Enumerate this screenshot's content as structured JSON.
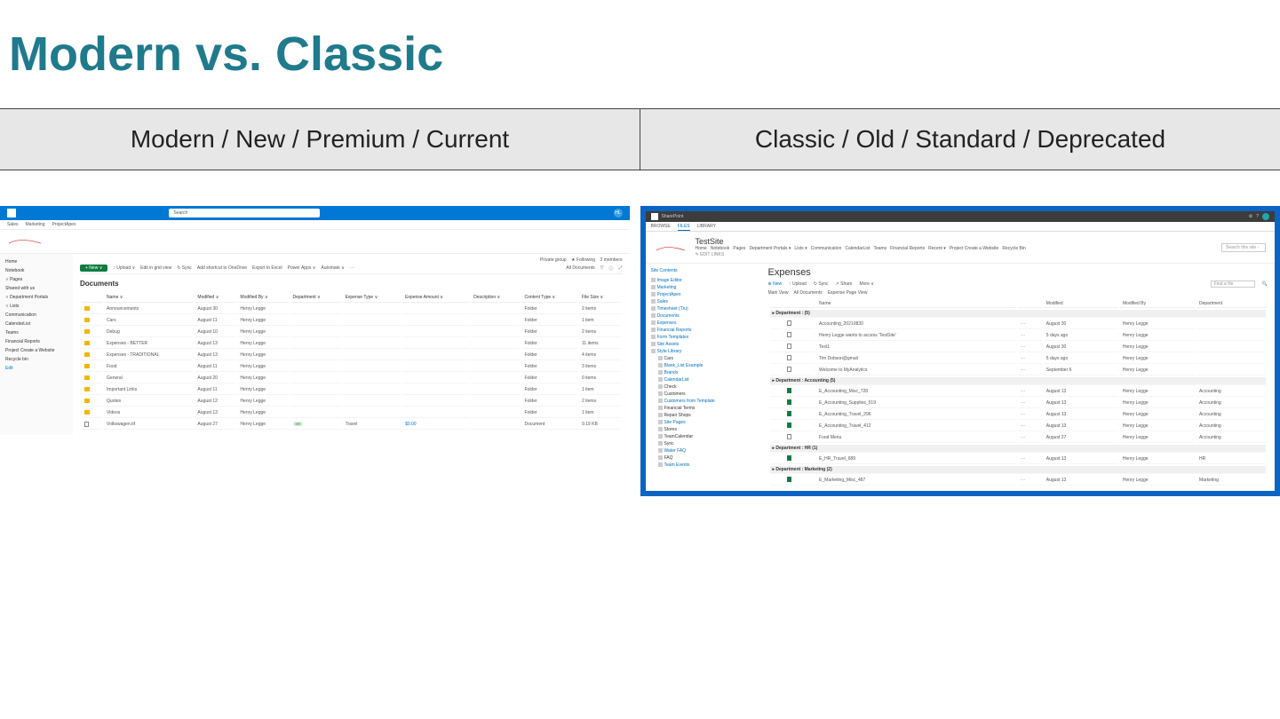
{
  "slide_title": "Modern vs. Classic",
  "header_left": "Modern / New / Premium / Current",
  "header_right": "Classic / Old / Standard / Deprecated",
  "modern": {
    "search_placeholder": "Search",
    "avatar": "HL",
    "tabs": [
      "Sales",
      "Marketing",
      "ProjectApex"
    ],
    "meta": {
      "group": "Private group",
      "follow": "★ Following",
      "members": "3 members"
    },
    "toolbar": {
      "new": "+ New ∨",
      "upload": "↑ Upload ∨",
      "edit": "Edit in grid view",
      "sync": "↻ Sync",
      "shortcut": "Add shortcut to OneDrive",
      "export": "Export to Excel",
      "powerapps": "Power Apps ∨",
      "automate": "Automate ∨",
      "more": "···",
      "alldocs": "All Documents"
    },
    "nav": [
      "Home",
      "Notebook",
      "Pages",
      "Shared with us",
      "Department Portals",
      "Lists",
      "Communication",
      "CalendarList",
      "Teams",
      "Financial Reports",
      "Project Create a Website",
      "Recycle bin",
      "Edit"
    ],
    "doctitle": "Documents",
    "columns": [
      "",
      "Name ∨",
      "Modified ∨",
      "Modified By ∨",
      "Department ∨",
      "Expense Type ∨",
      "Expense Amount ∨",
      "Description ∨",
      "Content Type ∨",
      "File Size ∨"
    ],
    "rows": [
      {
        "icon": "folder",
        "name": "Announcements",
        "mod": "August 30",
        "by": "Henry Legge",
        "ct": "Folder",
        "size": "2 items"
      },
      {
        "icon": "folder",
        "name": "Cars",
        "mod": "August 11",
        "by": "Henry Legge",
        "ct": "Folder",
        "size": "1 item"
      },
      {
        "icon": "folder",
        "name": "Debug",
        "mod": "August 10",
        "by": "Henry Legge",
        "ct": "Folder",
        "size": "2 items"
      },
      {
        "icon": "folder",
        "name": "Expenses - BETTER",
        "mod": "August 13",
        "by": "Henry Legge",
        "ct": "Folder",
        "size": "11 items"
      },
      {
        "icon": "folder",
        "name": "Expenses - TRADITIONAL",
        "mod": "August 13",
        "by": "Henry Legge",
        "ct": "Folder",
        "size": "4 items"
      },
      {
        "icon": "folder",
        "name": "Food",
        "mod": "August 11",
        "by": "Henry Legge",
        "ct": "Folder",
        "size": "3 items"
      },
      {
        "icon": "folder",
        "name": "General",
        "mod": "August 20",
        "by": "Henry Legge",
        "ct": "Folder",
        "size": "0 items"
      },
      {
        "icon": "folder",
        "name": "Important Links",
        "mod": "August 11",
        "by": "Henry Legge",
        "ct": "Folder",
        "size": "1 item"
      },
      {
        "icon": "folder",
        "name": "Quotes",
        "mod": "August 12",
        "by": "Henry Legge",
        "ct": "Folder",
        "size": "2 items"
      },
      {
        "icon": "folder",
        "name": "Videos",
        "mod": "August 13",
        "by": "Henry Legge",
        "ct": "Folder",
        "size": "1 item"
      },
      {
        "icon": "file",
        "name": "Volkswagen.tif",
        "mod": "August 27",
        "by": "Henry Legge",
        "dept": "HR",
        "etype": "Travel",
        "eamt": "$0.00",
        "ct": "Document",
        "size": "9.19 KB"
      }
    ]
  },
  "classic": {
    "product": "SharePoint",
    "ribbon": [
      "BROWSE",
      "FILES",
      "LIBRARY"
    ],
    "site": "TestSite",
    "crumbs": [
      "Home",
      "Notebook",
      "Pages",
      "Department Portals ▾",
      "Lists ▾",
      "Communication",
      "CalendarList",
      "Teams",
      "Financial Reports",
      "Recent ▾",
      "Project Create a Website",
      "Recycle Bin"
    ],
    "edit_links": "✎ EDIT LINKS",
    "search_placeholder": "Search this site",
    "nav_header": "Site Contents",
    "nav": [
      {
        "l": "Image Editor",
        "c": "lnk"
      },
      {
        "l": "Marketing",
        "c": "lnk"
      },
      {
        "l": "ProjectApex",
        "c": "lnk"
      },
      {
        "l": "Sales",
        "c": "lnk"
      },
      {
        "l": "Timesheet (Tru)",
        "c": "lnk"
      },
      {
        "l": "Documents",
        "c": "lnk"
      },
      {
        "l": "Expenses",
        "c": "lnk"
      },
      {
        "l": "Financial Reports",
        "c": "lnk"
      },
      {
        "l": "Form Templates",
        "c": "lnk"
      },
      {
        "l": "Site Assets",
        "c": "lnk"
      },
      {
        "l": "Style Library",
        "c": "lnk"
      },
      {
        "l": "Cars",
        "c": "sub"
      },
      {
        "l": "Blank_List Example",
        "c": "sub lnk"
      },
      {
        "l": "Brands",
        "c": "sub lnk"
      },
      {
        "l": "CalendarList",
        "c": "sub lnk"
      },
      {
        "l": "Check",
        "c": "sub"
      },
      {
        "l": "Customers",
        "c": "sub"
      },
      {
        "l": "Customers from Template",
        "c": "sub lnk"
      },
      {
        "l": "Financial Terms",
        "c": "sub"
      },
      {
        "l": "Repair Shops",
        "c": "sub"
      },
      {
        "l": "Site Pages",
        "c": "sub lnk"
      },
      {
        "l": "Stores",
        "c": "sub"
      },
      {
        "l": "TeamCalendar",
        "c": "sub"
      },
      {
        "l": "Sync",
        "c": "sub"
      },
      {
        "l": "Water FAQ",
        "c": "sub lnk"
      },
      {
        "l": "FAQ",
        "c": "sub"
      },
      {
        "l": "Team Events",
        "c": "sub lnk"
      }
    ],
    "title": "Expenses",
    "tools": {
      "new": "⊕ New",
      "upload": "↑ Upload",
      "sync": "↻ Sync",
      "share": "↗ Share",
      "more": "More ∨",
      "find": "Find a file"
    },
    "views": [
      "Main View",
      "All Documents",
      "Expense Page View"
    ],
    "columns": [
      "",
      "",
      "Name",
      "",
      "Modified",
      "Modified By",
      "Department"
    ],
    "groups": [
      {
        "label": "▸ Department :  (5)",
        "rows": [
          {
            "ico": "doc",
            "name": "Accounting_20210830",
            "dots": "···",
            "mod": "August 30",
            "by": "Henry Legge"
          },
          {
            "ico": "doc",
            "name": "Henry Legge wants to access 'TestSite'",
            "dots": "···",
            "mod": "5 days ago",
            "by": "Henry Legge"
          },
          {
            "ico": "doc",
            "name": "Test1",
            "dots": "···",
            "mod": "August 30",
            "by": "Henry Legge"
          },
          {
            "ico": "doc",
            "name": "Tim Dobson@gmail",
            "dots": "···",
            "mod": "5 days ago",
            "by": "Henry Legge"
          },
          {
            "ico": "doc",
            "name": "Welcome to MyAnalytics",
            "dots": "···",
            "mod": "September 6",
            "by": "Henry Legge"
          }
        ]
      },
      {
        "label": "▸ Department : Accounting (5)",
        "rows": [
          {
            "ico": "xl",
            "name": "E_Accounting_Misc_728",
            "dots": "···",
            "mod": "August 13",
            "by": "Henry Legge",
            "dept": "Accounting"
          },
          {
            "ico": "xl",
            "name": "E_Accounting_Supplies_519",
            "dots": "···",
            "mod": "August 13",
            "by": "Henry Legge",
            "dept": "Accounting"
          },
          {
            "ico": "xl",
            "name": "E_Accounting_Travel_296",
            "dots": "···",
            "mod": "August 13",
            "by": "Henry Legge",
            "dept": "Accounting"
          },
          {
            "ico": "xl",
            "name": "E_Accounting_Travel_412",
            "dots": "···",
            "mod": "August 13",
            "by": "Henry Legge",
            "dept": "Accounting"
          },
          {
            "ico": "doc",
            "name": "Food Menu",
            "dots": "···",
            "mod": "August 27",
            "by": "Henry Legge",
            "dept": "Accounting"
          }
        ]
      },
      {
        "label": "▸ Department : HR (1)",
        "rows": [
          {
            "ico": "xl",
            "name": "E_HR_Travel_689",
            "dots": "···",
            "mod": "August 13",
            "by": "Henry Legge",
            "dept": "HR"
          }
        ]
      },
      {
        "label": "▸ Department : Marketing (2)",
        "rows": [
          {
            "ico": "xl",
            "name": "E_Marketing_Misc_487",
            "dots": "···",
            "mod": "August 13",
            "by": "Henry Legge",
            "dept": "Marketing"
          }
        ]
      }
    ]
  }
}
